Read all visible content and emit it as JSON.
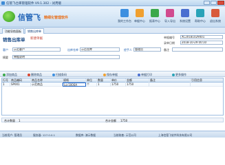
{
  "window": {
    "title": "信管飞仓库管理软件 V9.1.302 - 试用版"
  },
  "brand": {
    "name": "信管飞",
    "slogan": "精细化管理软件"
  },
  "topnav": [
    {
      "label": "我的工作台",
      "color": "#3c8fe0"
    },
    {
      "label": "单据中心",
      "color": "#f0a030"
    },
    {
      "label": "报表中心",
      "color": "#3aa84a"
    },
    {
      "label": "导入导出",
      "color": "#d14b8f"
    },
    {
      "label": "系统设置",
      "color": "#4a6fd0"
    },
    {
      "label": "帮助中心",
      "color": "#2aa3b8"
    },
    {
      "label": "退出系统",
      "color": "#d85a3a"
    }
  ],
  "tabs": [
    {
      "label": "功能导航面板"
    },
    {
      "label": "销售出库单"
    }
  ],
  "form": {
    "title": "销售出库单",
    "status": "新建单据",
    "doc_no_label": "单据编号",
    "doc_no": "XC20181029001",
    "date_label": "录单日期",
    "date": "2018-10-29 00:10",
    "customer_label": "客户",
    "customer": "示范客户",
    "warehouse_label": "出库仓库",
    "warehouse": "示范仓库",
    "handler_label": "经手人",
    "handler": "管理员",
    "note_label": "备注",
    "summary_label": "摘要",
    "summary": "单据说明"
  },
  "toolbar": [
    {
      "label": "添加商品",
      "color": "#3aa84a"
    },
    {
      "label": "删除商品",
      "color": "#d8452f"
    },
    {
      "label": "扫描条码",
      "color": "#3c8fe0"
    },
    {
      "label": "保存单据",
      "color": "#f0a030"
    },
    {
      "label": "单据打印",
      "color": "#4a6fd0"
    },
    {
      "label": "更多操作",
      "color": "#2aa3b8"
    }
  ],
  "table": {
    "columns": [
      "行号",
      "商品编码",
      "商品名称",
      "规格",
      "单位",
      "数量",
      "单价",
      "金额",
      "备注",
      "引用信息"
    ],
    "rows": [
      [
        "1",
        "SP001",
        "示范商品",
        "Lg-1000A",
        "个",
        "1",
        "1750",
        "1750",
        "",
        ""
      ]
    ]
  },
  "totals": {
    "qty_label": "合计数量",
    "qty": "1",
    "amount_label": "合计金额",
    "amount": "1750"
  },
  "status": {
    "user": "当前用户: 管理员",
    "server": "服务器: 127.0.0.1",
    "db": "数据库: 演示数据",
    "company": "当前账套: 示范公司",
    "copyright": "上海信管飞软件科技有限公司"
  }
}
